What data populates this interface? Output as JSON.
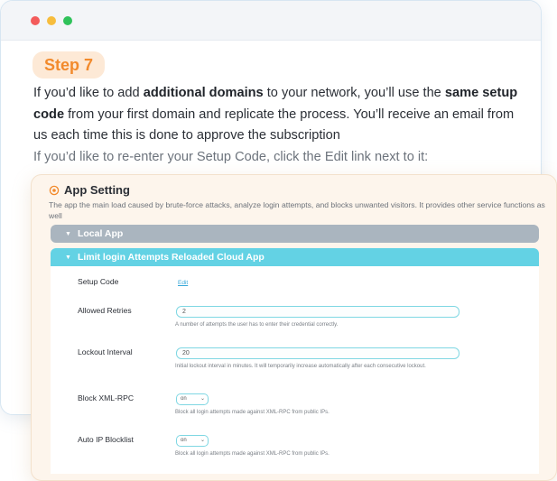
{
  "step": {
    "label": "Step 7"
  },
  "intro": {
    "part1": "If you’d like to add ",
    "bold1": "additional domains",
    "part2": " to your network, you’ll use the ",
    "bold2": "same setup code",
    "part3": " from your first domain and replicate the process. You’ll receive an email from us each time this is done to approve the subscription",
    "secondary": "If you’d like to re-enter your Setup Code, click the Edit link next to it:"
  },
  "panel": {
    "title": "App Setting",
    "description": "The app the main load caused by brute-force attacks, analyze login attempts, and blocks unwanted visitors. It provides other service functions as well",
    "local_bar": "Local App",
    "cloud_bar": "Limit login Attempts Reloaded Cloud App"
  },
  "settings": {
    "setup_code": {
      "label": "Setup Code",
      "link": "Edit"
    },
    "allowed_retries": {
      "label": "Allowed Retries",
      "value": "2",
      "help": "A number of attempts the user has to enter their credential correctly."
    },
    "lockout_interval": {
      "label": "Lockout Interval",
      "value": "20",
      "help": "Initial lockout interval in minutes. It will temporarily increase automatically after each consecutive lockout."
    },
    "block_xmlrpc": {
      "label": "Block XML-RPC",
      "value": "on",
      "help": "Block all login attempts made against XML-RPC from public IPs."
    },
    "auto_ip_blocklist": {
      "label": "Auto IP Blocklist",
      "value": "on",
      "help": "Block all login attempts made against XML-RPC from public IPs."
    }
  },
  "colors": {
    "accent": "#f28a2c",
    "cloud_bar": "#63d2e4",
    "local_bar": "#aab5bf"
  }
}
